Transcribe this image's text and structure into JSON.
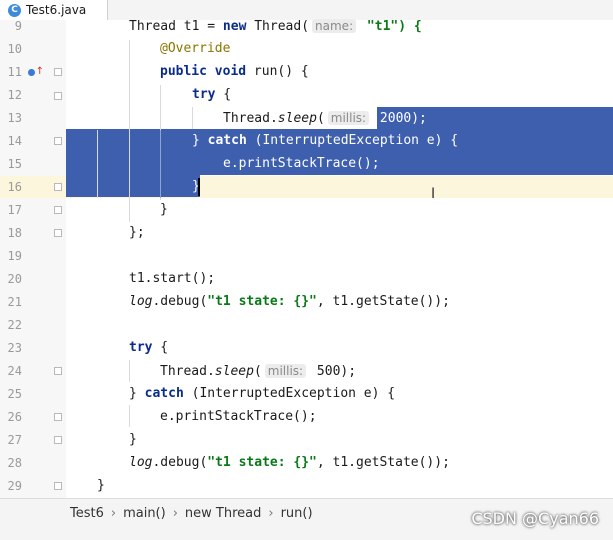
{
  "tab": {
    "icon": "C",
    "label": "Test6.java"
  },
  "line_numbers": [
    "9",
    "10",
    "11",
    "12",
    "13",
    "14",
    "15",
    "16",
    "17",
    "18",
    "19",
    "20",
    "21",
    "22",
    "23",
    "24",
    "25",
    "26",
    "27",
    "28",
    "29"
  ],
  "code": {
    "l9": {
      "a": "Thread t1 = ",
      "kw": "new",
      "b": " Thread(",
      "hint": "name:",
      "c": " \"t1\") {"
    },
    "l10": {
      "ann": "@Override"
    },
    "l11": {
      "kw": "public void",
      "b": " run() {"
    },
    "l12": {
      "kw": "try",
      "b": " {"
    },
    "l13": {
      "a": "Thread.",
      "it": "sleep",
      "b": "(",
      "hint": "millis:",
      "c": " 2000);"
    },
    "l14": {
      "a": "} ",
      "kw": "catch",
      "b": " (InterruptedException e) {"
    },
    "l15": {
      "a": "e.printStackTrace();"
    },
    "l16": {
      "a": "}"
    },
    "l17": {
      "a": "}"
    },
    "l18": {
      "a": "};"
    },
    "l20": {
      "a": "t1.start();"
    },
    "l21": {
      "it": "log",
      "a": ".debug(",
      "str": "\"t1 state: {}\"",
      "b": ", t1.getState());"
    },
    "l23": {
      "kw": "try",
      "b": " {"
    },
    "l24": {
      "a": "Thread.",
      "it": "sleep",
      "b": "(",
      "hint": "millis:",
      "c": " 500);"
    },
    "l25": {
      "a": "} ",
      "kw": "catch",
      "b": " (InterruptedException e) {"
    },
    "l26": {
      "a": "e.printStackTrace();"
    },
    "l27": {
      "a": "}"
    },
    "l28": {
      "it": "log",
      "a": ".debug(",
      "str": "\"t1 state: {}\"",
      "b": ", t1.getState());"
    },
    "l29": {
      "a": "}"
    }
  },
  "breadcrumbs": [
    "Test6",
    "main()",
    "new Thread",
    "run()"
  ],
  "watermark": "CSDN @Cyan66",
  "colors": {
    "selection": "#3d5fae",
    "current_line": "#fcf7dc",
    "keyword": "#0a2c8a",
    "string": "#0a7a18",
    "annotation": "#8a7500"
  }
}
